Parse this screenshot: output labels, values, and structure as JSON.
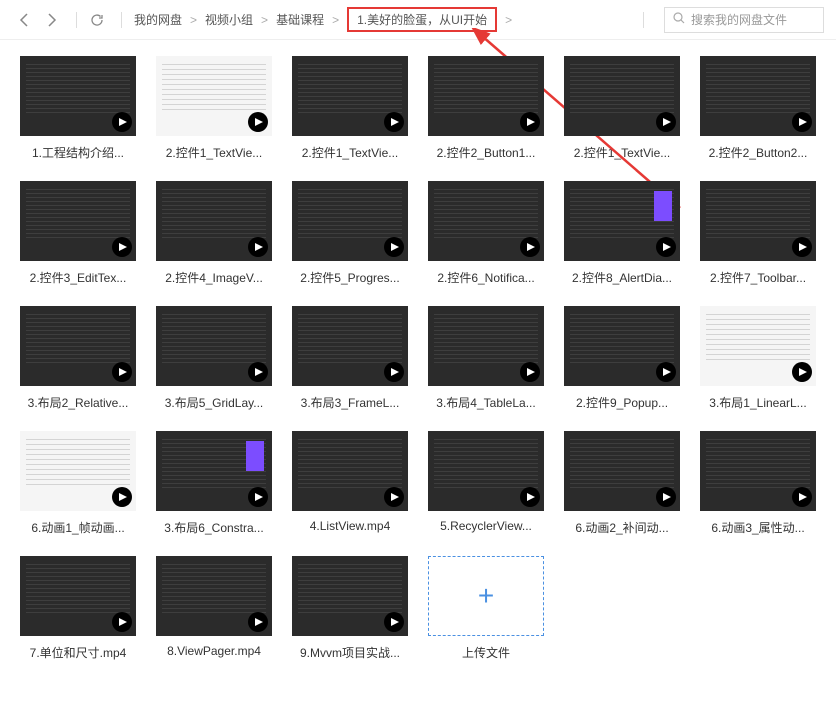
{
  "breadcrumb": {
    "items": [
      "我的网盘",
      "视频小组",
      "基础课程",
      "1.美好的脸蛋，从UI开始"
    ],
    "separator": ">",
    "highlighted_index": 3
  },
  "search": {
    "placeholder": "搜索我的网盘文件"
  },
  "upload": {
    "label": "上传文件",
    "symbol": "+"
  },
  "files": [
    {
      "name": "1.工程结构介绍...",
      "variant": "dark"
    },
    {
      "name": "2.控件1_TextVie...",
      "variant": "light"
    },
    {
      "name": "2.控件1_TextVie...",
      "variant": "dark"
    },
    {
      "name": "2.控件2_Button1...",
      "variant": "dark"
    },
    {
      "name": "2.控件1_TextVie...",
      "variant": "dark"
    },
    {
      "name": "2.控件2_Button2...",
      "variant": "dark"
    },
    {
      "name": "2.控件3_EditTex...",
      "variant": "dark"
    },
    {
      "name": "2.控件4_ImageV...",
      "variant": "dark"
    },
    {
      "name": "2.控件5_Progres...",
      "variant": "dark"
    },
    {
      "name": "2.控件6_Notifica...",
      "variant": "dark"
    },
    {
      "name": "2.控件8_AlertDia...",
      "variant": "accent"
    },
    {
      "name": "2.控件7_Toolbar...",
      "variant": "dark"
    },
    {
      "name": "3.布局2_Relative...",
      "variant": "dark"
    },
    {
      "name": "3.布局5_GridLay...",
      "variant": "dark"
    },
    {
      "name": "3.布局3_FrameL...",
      "variant": "dark"
    },
    {
      "name": "3.布局4_TableLa...",
      "variant": "dark"
    },
    {
      "name": "2.控件9_Popup...",
      "variant": "dark"
    },
    {
      "name": "3.布局1_LinearL...",
      "variant": "light"
    },
    {
      "name": "6.动画1_帧动画...",
      "variant": "light"
    },
    {
      "name": "3.布局6_Constra...",
      "variant": "accent"
    },
    {
      "name": "4.ListView.mp4",
      "variant": "dark"
    },
    {
      "name": "5.RecyclerView...",
      "variant": "dark"
    },
    {
      "name": "6.动画2_补间动...",
      "variant": "dark"
    },
    {
      "name": "6.动画3_属性动...",
      "variant": "dark"
    },
    {
      "name": "7.单位和尺寸.mp4",
      "variant": "dark"
    },
    {
      "name": "8.ViewPager.mp4",
      "variant": "dark"
    },
    {
      "name": "9.Mvvm项目实战...",
      "variant": "dark"
    }
  ],
  "annotation": {
    "color": "#e53935"
  }
}
